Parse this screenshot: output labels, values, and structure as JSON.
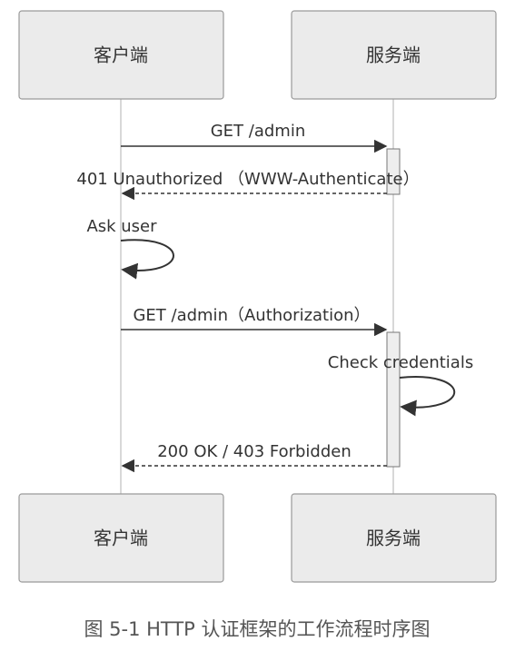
{
  "actors": {
    "client": "客户端",
    "server": "服务端"
  },
  "messages": {
    "m1": "GET /admin",
    "m2": "401 Unauthorized （WWW-Authenticate）",
    "m3": "Ask user",
    "m4": "GET /admin（Authorization）",
    "m5": "Check credentials",
    "m6": "200 OK / 403 Forbidden"
  },
  "caption": "图 5-1 HTTP 认证框架的工作流程时序图"
}
